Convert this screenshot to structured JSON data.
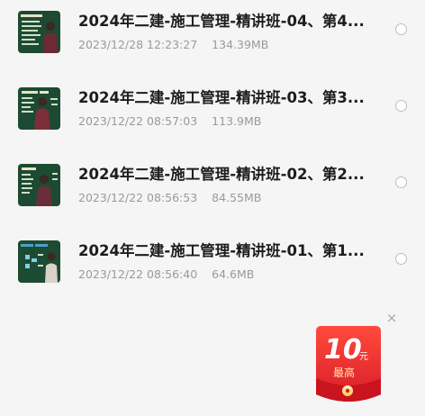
{
  "files": [
    {
      "title": "2024年二建-施工管理-精讲班-04、第4...",
      "date": "2023/12/28 12:23:27",
      "size": "134.39MB"
    },
    {
      "title": "2024年二建-施工管理-精讲班-03、第3...",
      "date": "2023/12/22 08:57:03",
      "size": "113.9MB"
    },
    {
      "title": "2024年二建-施工管理-精讲班-02、第2...",
      "date": "2023/12/22 08:56:53",
      "size": "84.55MB"
    },
    {
      "title": "2024年二建-施工管理-精讲班-01、第1...",
      "date": "2023/12/22 08:56:40",
      "size": "64.6MB"
    }
  ],
  "promo": {
    "close": "×",
    "amount": "10",
    "unit": "元",
    "caption": "最高"
  },
  "colors": {
    "title": "#1d1d1d",
    "meta": "#9a9a9a",
    "thumb_bg": "#1d4a32",
    "promo_red": "#e8252c",
    "promo_gold": "#ffd66b"
  }
}
